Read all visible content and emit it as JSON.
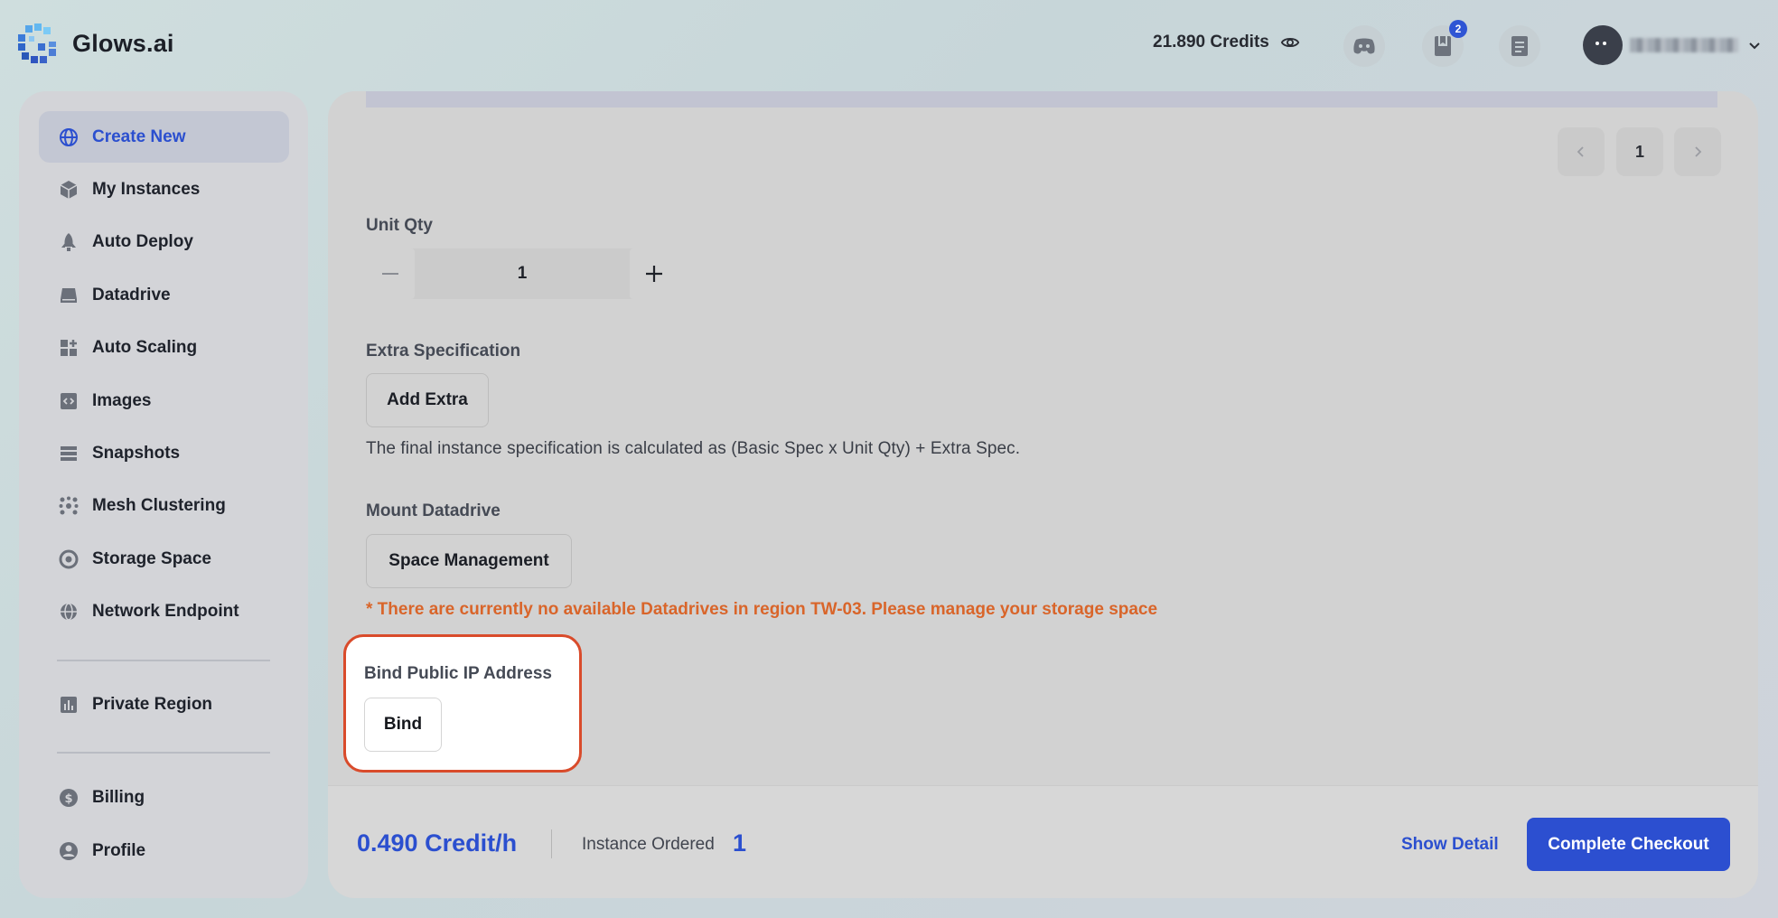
{
  "brand": {
    "name": "Glows.ai"
  },
  "header": {
    "credits": "21.890 Credits",
    "notifications_badge": "2",
    "icons": [
      "eye-icon",
      "discord-icon",
      "book-icon",
      "document-icon",
      "chevron-down-icon"
    ]
  },
  "sidebar": {
    "items": [
      {
        "label": "Create New",
        "icon": "globe-icon",
        "active": true
      },
      {
        "label": "My Instances",
        "icon": "cube-icon"
      },
      {
        "label": "Auto Deploy",
        "icon": "rocket-icon"
      },
      {
        "label": "Datadrive",
        "icon": "drive-icon"
      },
      {
        "label": "Auto Scaling",
        "icon": "grid-plus-icon"
      },
      {
        "label": "Images",
        "icon": "code-image-icon"
      },
      {
        "label": "Snapshots",
        "icon": "stack-icon"
      },
      {
        "label": "Mesh Clustering",
        "icon": "cluster-icon"
      },
      {
        "label": "Storage Space",
        "icon": "storage-icon"
      },
      {
        "label": "Network Endpoint",
        "icon": "network-globe-icon"
      }
    ],
    "secondary": [
      {
        "label": "Private Region",
        "icon": "bar-chart-icon"
      }
    ],
    "bottom": [
      {
        "label": "Billing",
        "icon": "dollar-icon"
      },
      {
        "label": "Profile",
        "icon": "user-icon"
      }
    ]
  },
  "main": {
    "pagination": {
      "current": "1"
    },
    "unit_qty": {
      "label": "Unit Qty",
      "value": "1"
    },
    "extra_spec": {
      "label": "Extra Specification",
      "button": "Add Extra",
      "note": "The final instance specification is calculated as (Basic Spec x Unit Qty) + Extra Spec."
    },
    "datadrive": {
      "label": "Mount Datadrive",
      "button": "Space Management",
      "warning": "* There are currently no available Datadrives in region TW-03. Please manage your storage space"
    },
    "public_ip": {
      "label": "Bind Public IP Address",
      "button": "Bind"
    }
  },
  "footer": {
    "price": "0.490 Credit/h",
    "ordered_label": "Instance Ordered",
    "ordered_value": "1",
    "show_detail": "Show Detail",
    "checkout": "Complete Checkout"
  },
  "colors": {
    "accent": "#2c4fd0",
    "warning": "#d9652a",
    "highlight_border": "#d94b2b"
  }
}
